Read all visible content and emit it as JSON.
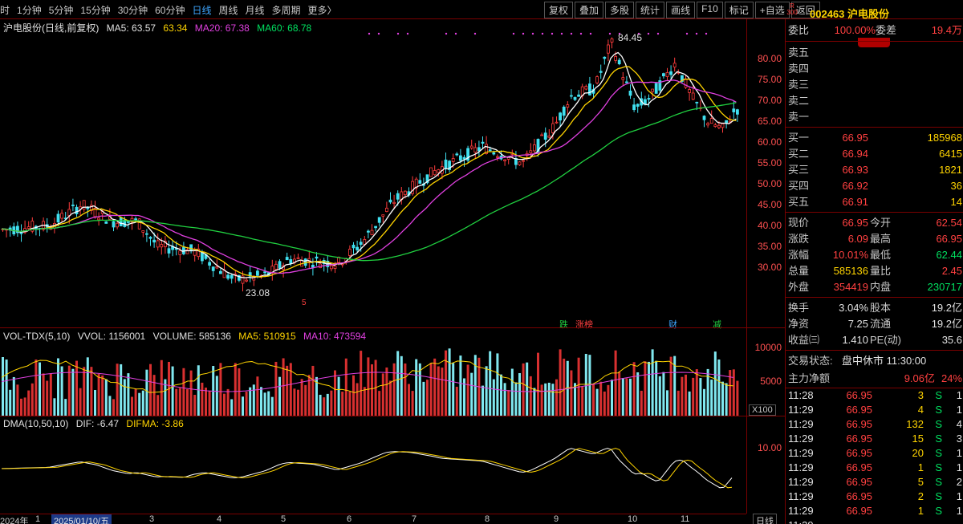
{
  "toolbar": {
    "periods": [
      "时",
      "1分钟",
      "5分钟",
      "15分钟",
      "30分钟",
      "60分钟",
      "日线",
      "周线",
      "月线",
      "多周期",
      "更多〉"
    ],
    "active_period": "日线",
    "actions": [
      "复权",
      "叠加",
      "多股",
      "统计",
      "画线",
      "F10",
      "标记",
      "+自选",
      "返回"
    ]
  },
  "stock": {
    "index_tag": "R 300",
    "code_name": "002463 沪电股份"
  },
  "main_chart": {
    "title": "沪电股份(日线,前复权)",
    "ma5_label": "MA5: 63.57",
    "ma10_label": "63.34",
    "ma20_label": "MA20: 67.38",
    "ma60_label": "MA60: 68.78",
    "high_label": "84.45",
    "low_label": "23.08",
    "y_ticks": [
      "80.00",
      "75.00",
      "70.00",
      "65.00",
      "60.00",
      "55.00",
      "50.00",
      "45.00",
      "40.00",
      "35.00",
      "30.00"
    ],
    "markers": [
      "跌",
      "涨榜",
      "财",
      "减"
    ],
    "low_marker": "5"
  },
  "volume_chart": {
    "title": "VOL-TDX(5,10)",
    "vvol": "VVOL: 1156001",
    "volume": "VOLUME: 585136",
    "ma5": "MA5: 510915",
    "ma10": "MA10: 473594",
    "y_ticks": [
      "10000",
      "5000"
    ],
    "unit": "X100"
  },
  "dma_chart": {
    "title": "DMA(10,50,10)",
    "dif": "DIF: -6.47",
    "difma": "DIFMA: -3.86",
    "y_ticks": [
      "10.00"
    ]
  },
  "date_axis": {
    "labels": [
      "2024年",
      "1",
      "2025/01/10/五",
      "3",
      "4",
      "5",
      "6",
      "7",
      "8",
      "9",
      "10",
      "11"
    ],
    "period_button": "日线"
  },
  "quote": {
    "weibi_label": "委比",
    "weibi_value": "100.00%",
    "weicha_label": "委差",
    "weicha_value": "19.4万",
    "sells": [
      {
        "label": "卖五",
        "price": "",
        "vol": ""
      },
      {
        "label": "卖四",
        "price": "",
        "vol": ""
      },
      {
        "label": "卖三",
        "price": "",
        "vol": ""
      },
      {
        "label": "卖二",
        "price": "",
        "vol": ""
      },
      {
        "label": "卖一",
        "price": "",
        "vol": ""
      }
    ],
    "buys": [
      {
        "label": "买一",
        "price": "66.95",
        "vol": "185968"
      },
      {
        "label": "买二",
        "price": "66.94",
        "vol": "6415"
      },
      {
        "label": "买三",
        "price": "66.93",
        "vol": "1821"
      },
      {
        "label": "买四",
        "price": "66.92",
        "vol": "36"
      },
      {
        "label": "买五",
        "price": "66.91",
        "vol": "14"
      }
    ],
    "stats": [
      {
        "l": "现价",
        "m": "66.95",
        "n": "今开",
        "r": "62.54"
      },
      {
        "l": "涨跌",
        "m": "6.09",
        "n": "最高",
        "r": "66.95"
      },
      {
        "l": "涨幅",
        "m": "10.01%",
        "n": "最低",
        "r": "62.44"
      },
      {
        "l": "总量",
        "m": "585136",
        "n": "量比",
        "r": "2.45"
      },
      {
        "l": "外盘",
        "m": "354419",
        "n": "内盘",
        "r": "230717"
      }
    ],
    "fundamentals": [
      {
        "l": "换手",
        "m": "3.04%",
        "n": "股本",
        "r": "19.2亿"
      },
      {
        "l": "净资",
        "m": "7.25",
        "n": "流通",
        "r": "19.2亿"
      },
      {
        "l": "收益㈢",
        "m": "1.410",
        "n": "PE(动)",
        "r": "35.6"
      }
    ],
    "status_label": "交易状态:",
    "status_value": "盘中休市 11:30:00",
    "netflow_label": "主力净额",
    "netflow_value": "9.06亿",
    "netflow_pct": "24%"
  },
  "ticks": [
    {
      "t": "11:28",
      "p": "66.95",
      "v": "3",
      "s": "S",
      "n": "1"
    },
    {
      "t": "11:29",
      "p": "66.95",
      "v": "4",
      "s": "S",
      "n": "1"
    },
    {
      "t": "11:29",
      "p": "66.95",
      "v": "132",
      "s": "S",
      "n": "4"
    },
    {
      "t": "11:29",
      "p": "66.95",
      "v": "15",
      "s": "S",
      "n": "3"
    },
    {
      "t": "11:29",
      "p": "66.95",
      "v": "20",
      "s": "S",
      "n": "1"
    },
    {
      "t": "11:29",
      "p": "66.95",
      "v": "1",
      "s": "S",
      "n": "1"
    },
    {
      "t": "11:29",
      "p": "66.95",
      "v": "5",
      "s": "S",
      "n": "2"
    },
    {
      "t": "11:29",
      "p": "66.95",
      "v": "2",
      "s": "S",
      "n": "1"
    },
    {
      "t": "11:29",
      "p": "66.95",
      "v": "1",
      "s": "S",
      "n": "1"
    },
    {
      "t": "11:29",
      "p": "",
      "v": "",
      "s": "",
      "n": ""
    }
  ]
}
